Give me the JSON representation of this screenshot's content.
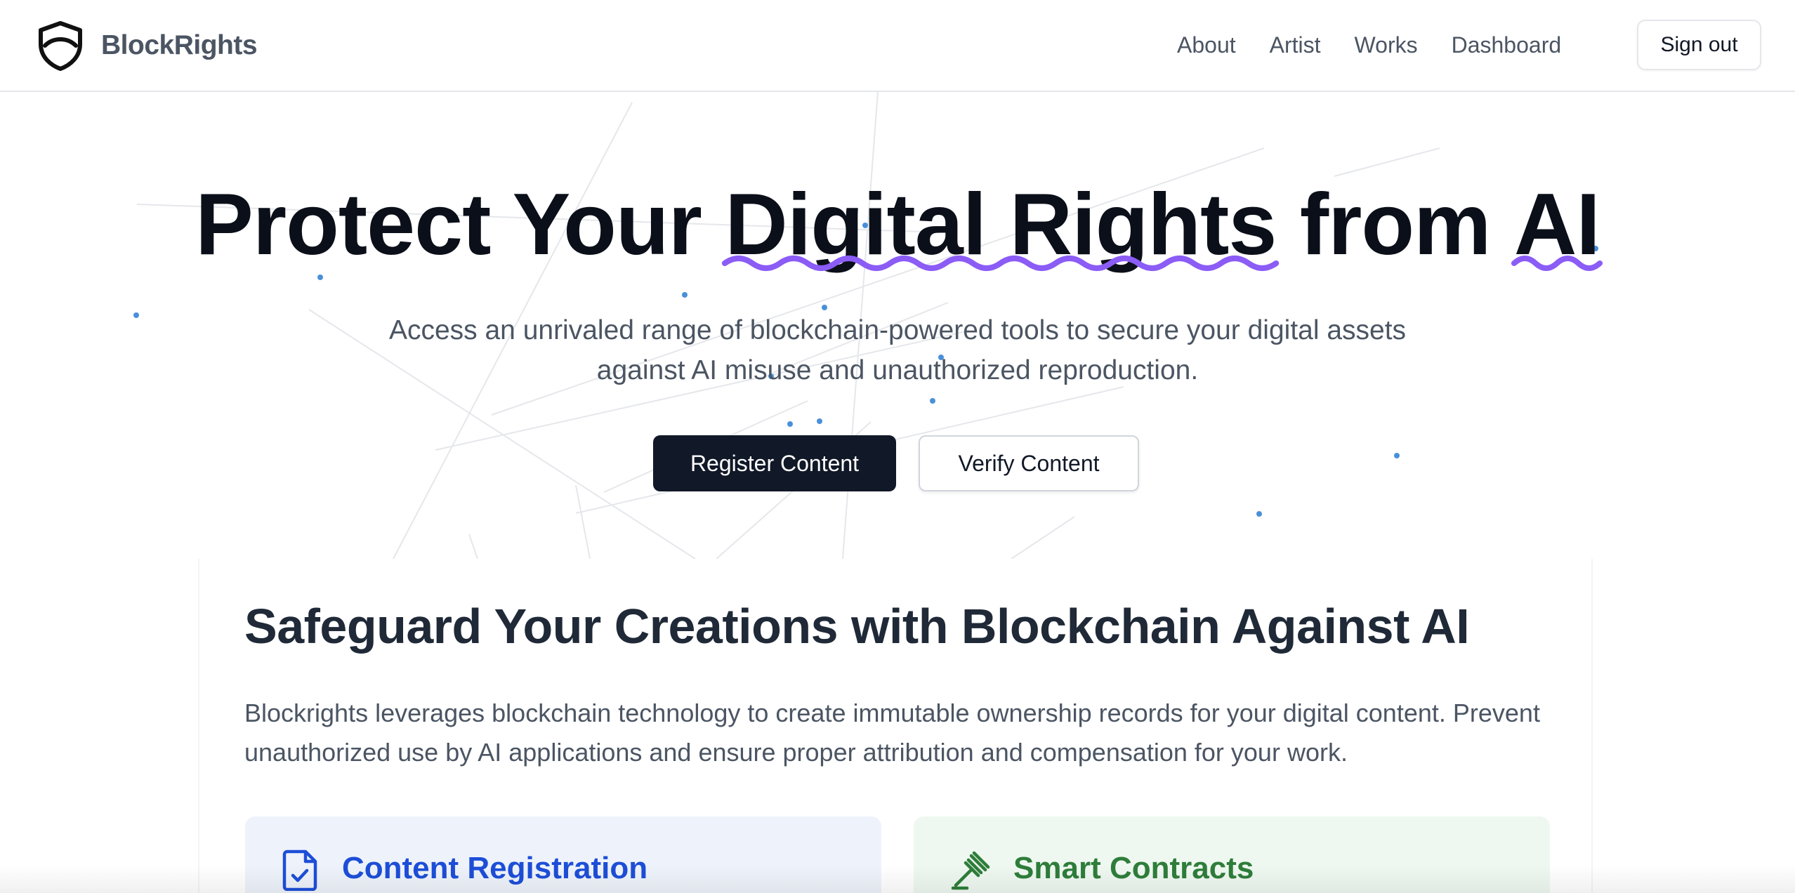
{
  "header": {
    "brand_name": "BlockRights",
    "logo_icon": "shield-icon",
    "nav": [
      {
        "label": "About"
      },
      {
        "label": "Artist"
      },
      {
        "label": "Works"
      },
      {
        "label": "Dashboard"
      }
    ],
    "sign_out_label": "Sign out"
  },
  "hero": {
    "title_part1": "Protect Your ",
    "title_highlight1": "Digital Rights",
    "title_part2": " from ",
    "title_highlight2": "AI",
    "subtitle": "Access an unrivaled range of blockchain-powered tools to secure your digital assets against AI misuse and unauthorized reproduction.",
    "primary_button": "Register Content",
    "secondary_button": "Verify Content",
    "underline_color": "#8b5cf6",
    "particle_color": "#4a90d9"
  },
  "section": {
    "title": "Safeguard Your Creations with Blockchain Against AI",
    "text": "Blockrights leverages blockchain technology to create immutable ownership records for your digital content. Prevent unauthorized use by AI applications and ensure proper attribution and compensation for your work.",
    "features": [
      {
        "label": "Content Registration",
        "icon": "file-check-icon",
        "color": "#1d4ed8"
      },
      {
        "label": "Smart Contracts",
        "icon": "gavel-icon",
        "color": "#2e7d3a"
      }
    ]
  }
}
